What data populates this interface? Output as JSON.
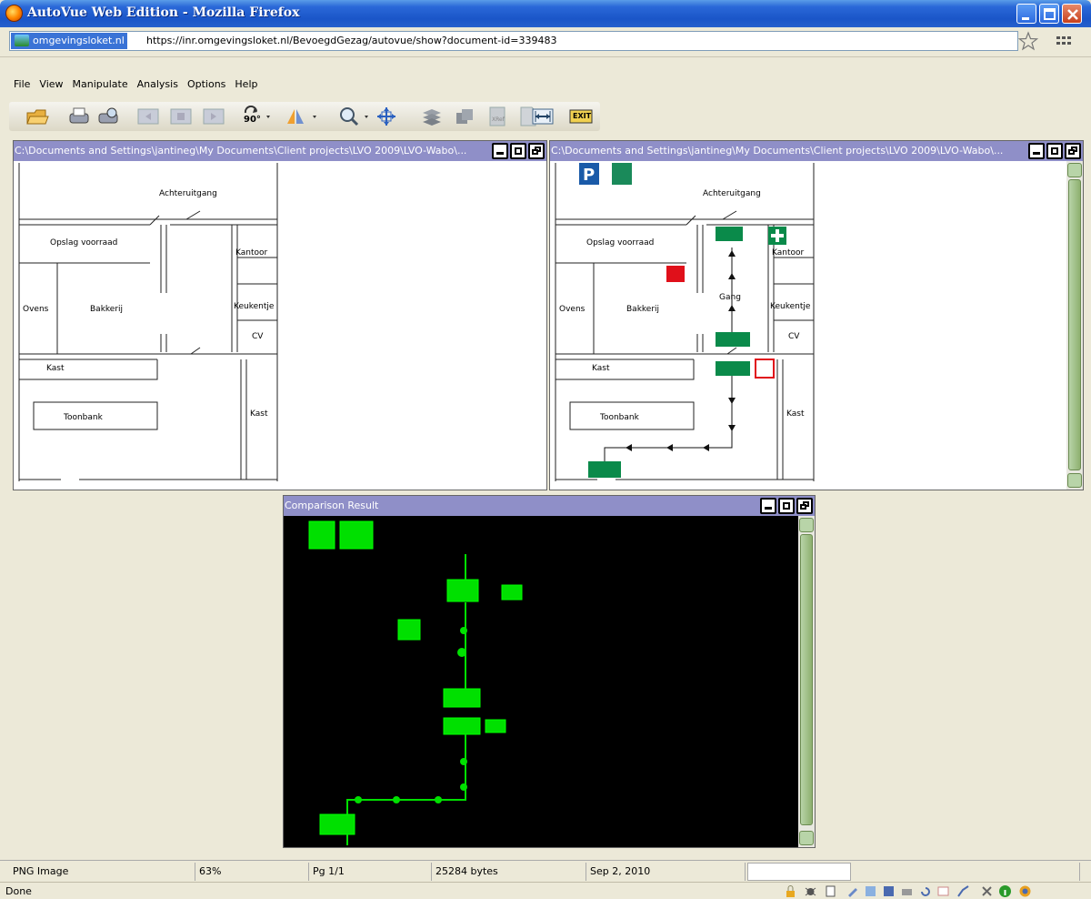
{
  "window": {
    "title": "AutoVue Web Edition - Mozilla Firefox"
  },
  "addressbar": {
    "site": "omgevingsloket.nl",
    "url": "https://inr.omgevingsloket.nl/BevoegdGezag/autovue/show?document-id=339483"
  },
  "menu": [
    "File",
    "View",
    "Manipulate",
    "Analysis",
    "Options",
    "Help"
  ],
  "toolbar": {
    "rotate_label": "90°",
    "exit_label": "EXIT",
    "icons": [
      "open-icon",
      "print-icon",
      "print-preview-icon",
      "prev-page-icon",
      "page-icon",
      "next-page-icon",
      "rotate-icon",
      "mirror-icon",
      "zoom-icon",
      "pan-icon",
      "layers-icon",
      "blocks-icon",
      "xref-icon",
      "document-icon",
      "measure-icon",
      "exit-icon"
    ]
  },
  "panels": {
    "left_title": "C:\\Documents and Settings\\jantineg\\My Documents\\Client projects\\LVO 2009\\LVO-Wabo\\...",
    "right_title": "C:\\Documents and Settings\\jantineg\\My Documents\\Client projects\\LVO 2009\\LVO-Wabo\\...",
    "comparison_title": "Comparison Result"
  },
  "floorplan": {
    "achteruitgang": "Achteruitgang",
    "opslag": "Opslag voorraad",
    "kantoor": "Kantoor",
    "ovens": "Ovens",
    "bakkerij": "Bakkerij",
    "keukentje": "Keukentje",
    "cv": "CV",
    "kast": "Kast",
    "toonbank": "Toonbank",
    "gang": "Gang"
  },
  "status": {
    "type": "PNG Image",
    "zoom": "63%",
    "page": "Pg 1/1",
    "size": "25284 bytes",
    "date": "Sep 2, 2010"
  },
  "browser_status": "Done"
}
